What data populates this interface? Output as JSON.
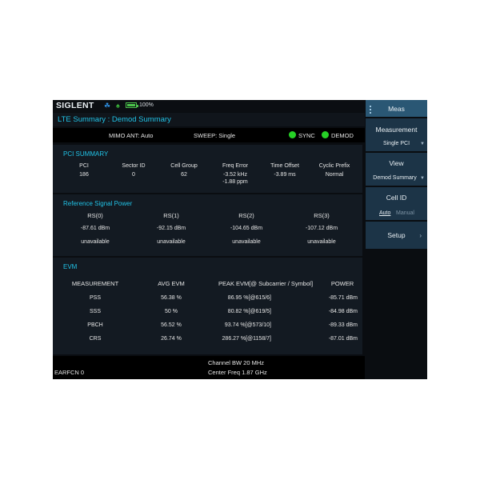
{
  "topbar": {
    "brand": "SIGLENT",
    "battery_percent": "100%",
    "battery_level": 1.0,
    "usb_icon": "usb-icon",
    "lan_icon": "lan-icon"
  },
  "title": "LTE Summary : Demod Summary",
  "status": {
    "mimo": "MIMO ANT: Auto",
    "sweep": "SWEEP: Single",
    "sync": "SYNC",
    "demod": "DEMOD",
    "sync_color": "#26d126",
    "demod_color": "#26d126"
  },
  "pci_summary": {
    "title": "PCI SUMMARY",
    "headers": [
      "PCI",
      "Sector ID",
      "Cell Group",
      "Freq Error",
      "Time Offset",
      "Cyclic Prefix"
    ],
    "values": [
      "186",
      "0",
      "62",
      "-3.52 kHz",
      "-3.89 ms",
      "Normal"
    ],
    "freq_error_ppm": "-1.88 ppm"
  },
  "ref_signal": {
    "title": "Reference Signal Power",
    "headers": [
      "RS(0)",
      "RS(1)",
      "RS(2)",
      "RS(3)"
    ],
    "power": [
      "-87.61 dBm",
      "-92.15 dBm",
      "-104.65 dBm",
      "-107.12 dBm"
    ],
    "status": [
      "unavailable",
      "unavailable",
      "unavailable",
      "unavailable"
    ]
  },
  "evm": {
    "title": "EVM",
    "headers": [
      "MEASUREMENT",
      "AVG EVM",
      "PEAK EVM[@ Subcarrier / Symbol]",
      "POWER"
    ],
    "rows": [
      [
        "PSS",
        "56.38 %",
        "86.95 %[@615/6]",
        "-85.71 dBm"
      ],
      [
        "SSS",
        "50 %",
        "80.82 %[@619/5]",
        "-84.98 dBm"
      ],
      [
        "PBCH",
        "56.52 %",
        "93.74 %[@573/10]",
        "-89.33 dBm"
      ],
      [
        "CRS",
        "26.74 %",
        "286.27 %[@1158/7]",
        "-87.01 dBm"
      ]
    ]
  },
  "bottom": {
    "earfcn": "EARFCN  0",
    "channel_bw": "Channel BW  20 MHz",
    "center_freq": "Center Freq  1.87 GHz"
  },
  "menu": {
    "header": "Meas",
    "measurement": {
      "label": "Measurement",
      "value": "Single PCI"
    },
    "view": {
      "label": "View",
      "value": "Demod Summary"
    },
    "cell_id": {
      "label": "Cell ID",
      "auto": "Auto",
      "manual": "Manual"
    },
    "setup": {
      "label": "Setup"
    }
  }
}
